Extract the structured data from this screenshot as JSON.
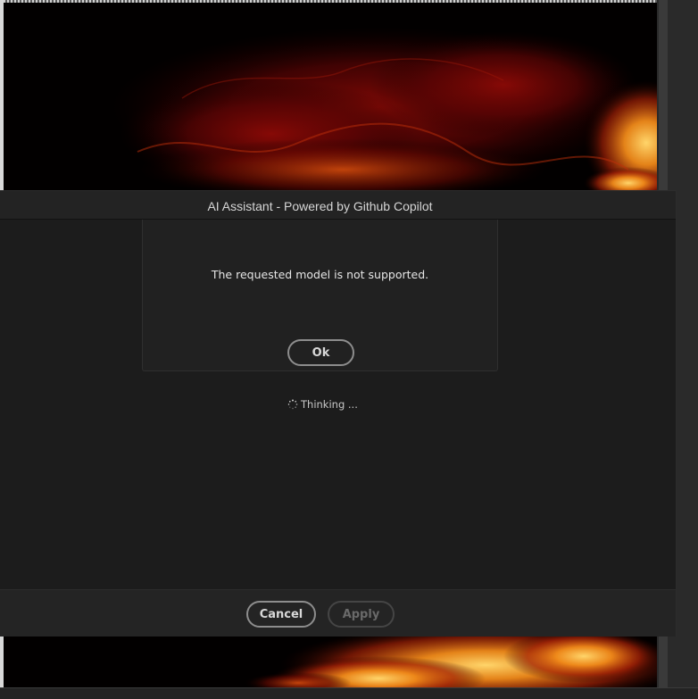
{
  "dialog": {
    "title": "AI Assistant - Powered by Github Copilot"
  },
  "alert": {
    "message": "The requested model is not supported.",
    "ok_label": "Ok"
  },
  "status": {
    "thinking_label": "Thinking ...",
    "spinner_icon": "loading-spinner-icon"
  },
  "footer": {
    "cancel_label": "Cancel",
    "apply_label": "Apply",
    "apply_enabled": false
  },
  "colors": {
    "dialog_bg": "#1c1c1c",
    "titlebar_bg": "#232323",
    "footer_bg": "#242424",
    "button_border": "#8d8d8d",
    "disabled_text": "#6a6a6a"
  }
}
